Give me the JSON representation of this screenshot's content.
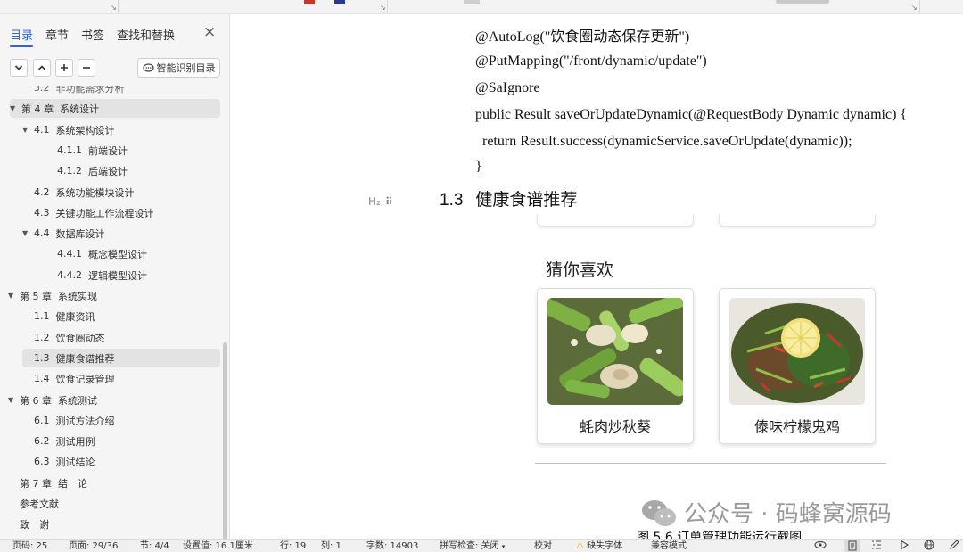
{
  "nav": {
    "tabs": [
      "目录",
      "章节",
      "书签",
      "查找和替换"
    ],
    "active_tab": "目录",
    "close_icon": "×",
    "tool_icons": [
      "chevron-down-icon",
      "chevron-up-icon",
      "plus-icon",
      "minus-icon"
    ],
    "smart_button": "智能识别目录",
    "toc": [
      {
        "num": "3.2",
        "text": "非功能需求分析",
        "level": 2,
        "cut": true
      },
      {
        "num": "第 4 章",
        "text": "系统设计",
        "level": 1,
        "expanded": true,
        "highlight": true
      },
      {
        "num": "4.1",
        "text": "系统架构设计",
        "level": 2,
        "expanded": true
      },
      {
        "num": "4.1.1",
        "text": "前端设计",
        "level": 3
      },
      {
        "num": "4.1.2",
        "text": "后端设计",
        "level": 3
      },
      {
        "num": "4.2",
        "text": "系统功能模块设计",
        "level": 2
      },
      {
        "num": "4.3",
        "text": "关键功能工作流程设计",
        "level": 2
      },
      {
        "num": "4.4",
        "text": "数据库设计",
        "level": 2,
        "expanded": true
      },
      {
        "num": "4.4.1",
        "text": "概念模型设计",
        "level": 3
      },
      {
        "num": "4.4.2",
        "text": "逻辑模型设计",
        "level": 3
      },
      {
        "num": "第 5 章",
        "text": "系统实现",
        "level": 1,
        "expanded": true
      },
      {
        "num": "1.1",
        "text": "健康资讯",
        "level": 2
      },
      {
        "num": "1.2",
        "text": "饮食圈动态",
        "level": 2
      },
      {
        "num": "1.3",
        "text": "健康食谱推荐",
        "level": 2,
        "selected": true
      },
      {
        "num": "1.4",
        "text": "饮食记录管理",
        "level": 2
      },
      {
        "num": "第 6 章",
        "text": "系统测试",
        "level": 1,
        "expanded": true
      },
      {
        "num": "6.1",
        "text": "测试方法介绍",
        "level": 2
      },
      {
        "num": "6.2",
        "text": "测试用例",
        "level": 2
      },
      {
        "num": "6.3",
        "text": "测试结论",
        "level": 2
      },
      {
        "num": "第 7 章",
        "text": "结　论",
        "level": 1
      },
      {
        "num": "",
        "text": "参考文献",
        "level": 1
      },
      {
        "num": "",
        "text": "致　谢",
        "level": 1
      }
    ]
  },
  "document": {
    "code_lines": [
      "@AutoLog(\"饮食圈动态保存更新\")",
      "@PutMapping(\"/front/dynamic/update\")",
      "@SaIgnore",
      "public Result saveOrUpdateDynamic(@RequestBody Dynamic dynamic) {",
      "  return Result.success(dynamicService.saveOrUpdate(dynamic));",
      "}"
    ],
    "heading_marker": "H₂",
    "heading_number": "1.3",
    "heading_text": "健康食谱推荐",
    "screenshot": {
      "section_title": "猜你喜欢",
      "cards": [
        {
          "name": "蚝肉炒秋葵",
          "image": "okra-oyster-dish-photo"
        },
        {
          "name": "傣味柠檬鬼鸡",
          "image": "lemon-chicken-dish-photo"
        }
      ]
    },
    "caption_partial": "图 5.6  订单管理功能运行截图",
    "watermark": "公众号 · 码蜂窝源码"
  },
  "status": {
    "page_num": "页码: 25",
    "page_count": "页面: 29/36",
    "section": "节: 4/4",
    "setting": "设置值: 16.1厘米",
    "line": "行: 19",
    "column": "列: 1",
    "word_count": "字数: 14903",
    "spell_check": "拼写检查: 关闭",
    "proofread": "校对",
    "missing_font": "缺失字体",
    "compat_mode": "兼容模式",
    "icons": [
      "eye-icon",
      "page-view-icon",
      "outline-view-icon",
      "play-icon",
      "globe-icon",
      "pen-icon"
    ]
  }
}
